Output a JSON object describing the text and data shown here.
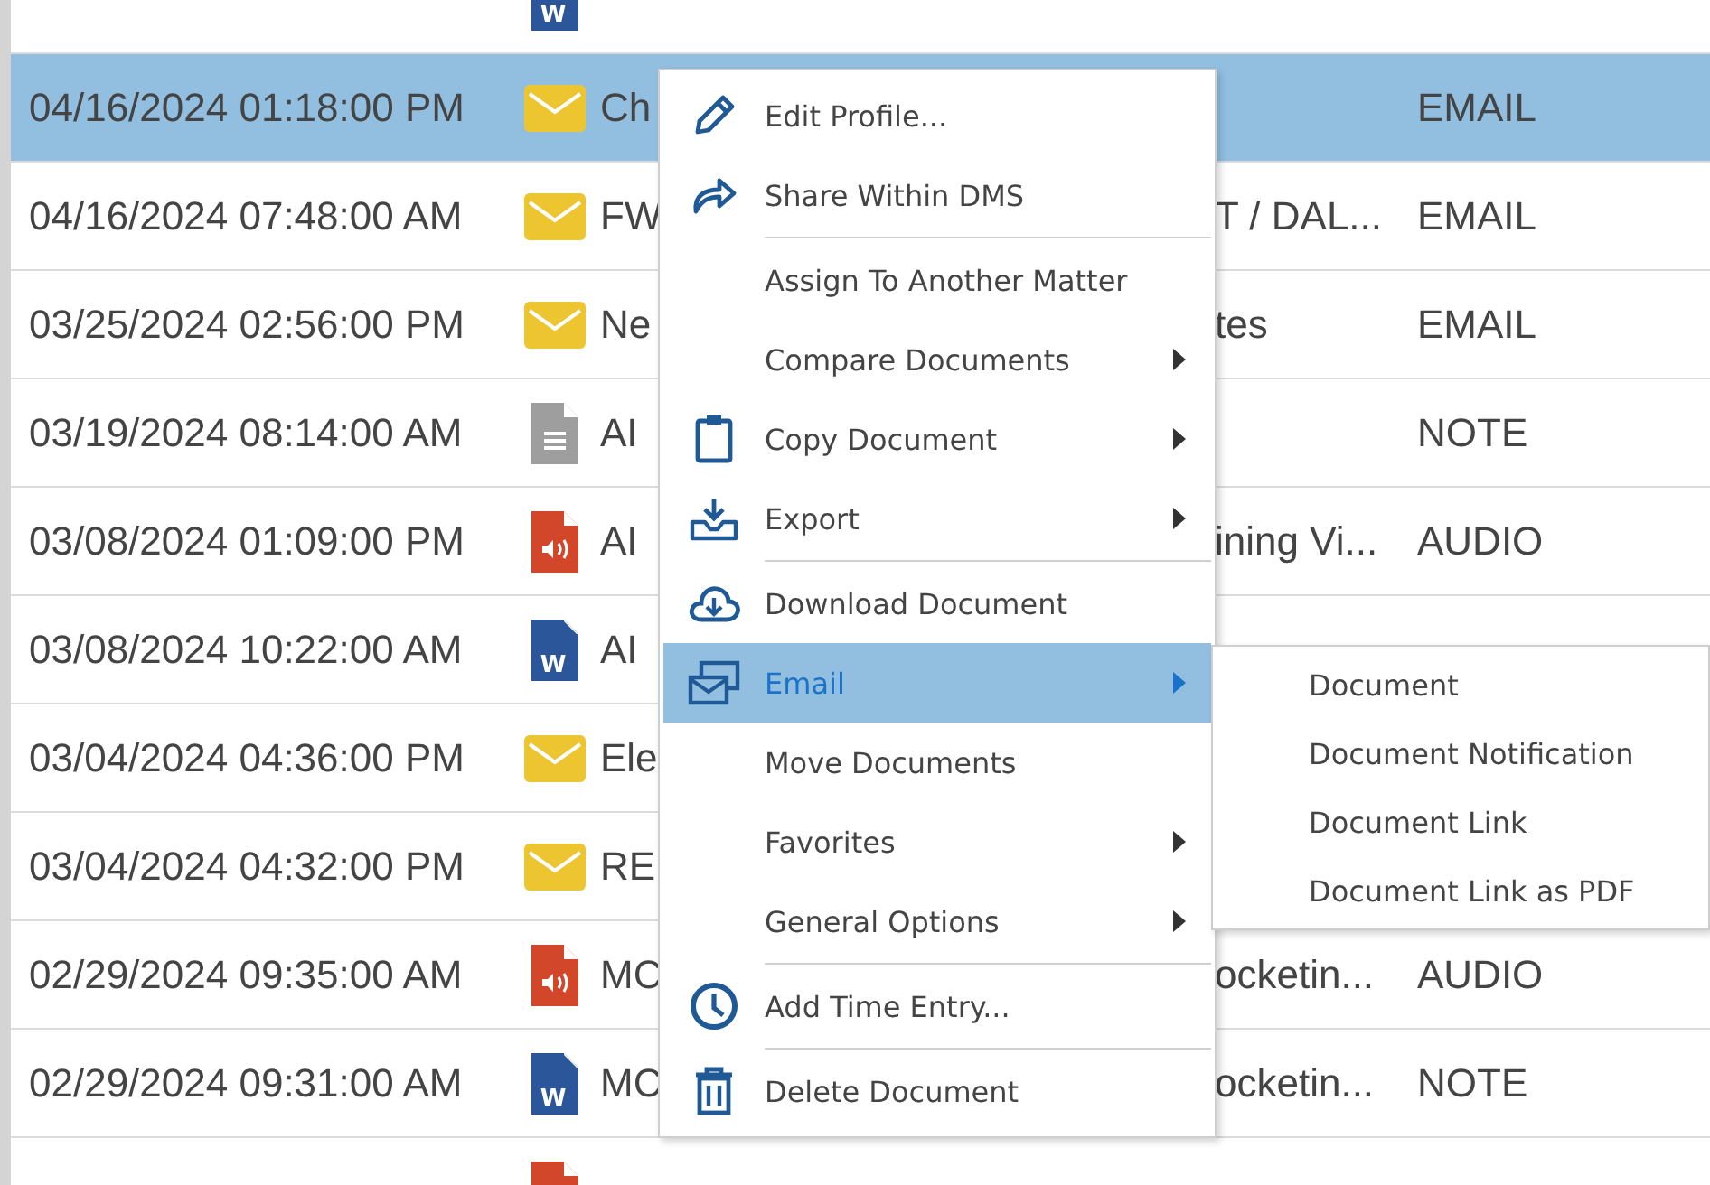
{
  "rows": [
    {
      "date": "",
      "kind": "word",
      "icon_text": "W",
      "name": "",
      "name_tail": "",
      "type": "",
      "selected": false
    },
    {
      "date": "04/16/2024 01:18:00 PM",
      "kind": "email",
      "name": "Ch",
      "name_tail": "",
      "type": "EMAIL",
      "selected": true
    },
    {
      "date": "04/16/2024 07:48:00 AM",
      "kind": "email",
      "name": "FW",
      "name_tail": "T / DAL...",
      "type": "EMAIL",
      "selected": false
    },
    {
      "date": "03/25/2024 02:56:00 PM",
      "kind": "email",
      "name": "Ne",
      "name_tail": "tes",
      "type": "EMAIL",
      "selected": false
    },
    {
      "date": "03/19/2024 08:14:00 AM",
      "kind": "note",
      "name": "AI",
      "name_tail": "",
      "type": "NOTE",
      "selected": false
    },
    {
      "date": "03/08/2024 01:09:00 PM",
      "kind": "audio",
      "name": "AI",
      "name_tail": "ining Vi...",
      "type": "AUDIO",
      "selected": false
    },
    {
      "date": "03/08/2024 10:22:00 AM",
      "kind": "word",
      "icon_text": "W",
      "name": "AI",
      "name_tail": "",
      "type": "",
      "selected": false
    },
    {
      "date": "03/04/2024 04:36:00 PM",
      "kind": "email",
      "name": "Ele",
      "name_tail": "",
      "type": "",
      "selected": false
    },
    {
      "date": "03/04/2024 04:32:00 PM",
      "kind": "email",
      "name": "RE",
      "name_tail": "",
      "type": "",
      "selected": false
    },
    {
      "date": "02/29/2024 09:35:00 AM",
      "kind": "audio",
      "name": "MC",
      "name_tail": "ocketin...",
      "type": "AUDIO",
      "selected": false
    },
    {
      "date": "02/29/2024 09:31:00 AM",
      "kind": "word",
      "icon_text": "W",
      "name": "MC",
      "name_tail": "ocketin...",
      "type": "NOTE",
      "selected": false
    },
    {
      "date": "",
      "kind": "audio",
      "name": "",
      "name_tail": "",
      "type": "",
      "selected": false
    }
  ],
  "context_menu": {
    "items": [
      {
        "label": "Edit Profile...",
        "kind": "pencil",
        "separator_before": false,
        "has_submenu": false,
        "selected": false
      },
      {
        "label": "Share Within DMS",
        "kind": "share",
        "separator_before": false,
        "has_submenu": false,
        "selected": false
      },
      {
        "label": "Assign To Another Matter",
        "kind": "plain",
        "separator_before": true,
        "has_submenu": false,
        "selected": false
      },
      {
        "label": "Compare Documents",
        "kind": "plain",
        "separator_before": false,
        "has_submenu": true,
        "selected": false
      },
      {
        "label": "Copy Document",
        "kind": "clipboard",
        "separator_before": false,
        "has_submenu": true,
        "selected": false
      },
      {
        "label": "Export",
        "kind": "tray",
        "separator_before": false,
        "has_submenu": true,
        "selected": false
      },
      {
        "label": "Download Document",
        "kind": "cloud",
        "separator_before": true,
        "has_submenu": false,
        "selected": false
      },
      {
        "label": "Email",
        "kind": "envelope",
        "separator_before": false,
        "has_submenu": true,
        "selected": true
      },
      {
        "label": "Move Documents",
        "kind": "plain",
        "separator_before": false,
        "has_submenu": false,
        "selected": false
      },
      {
        "label": "Favorites",
        "kind": "plain",
        "separator_before": false,
        "has_submenu": true,
        "selected": false
      },
      {
        "label": "General Options",
        "kind": "plain",
        "separator_before": false,
        "has_submenu": true,
        "selected": false
      },
      {
        "label": "Add Time Entry...",
        "kind": "clock",
        "separator_before": true,
        "has_submenu": false,
        "selected": false
      },
      {
        "label": "Delete Document",
        "kind": "trash",
        "separator_before": true,
        "has_submenu": false,
        "selected": false
      }
    ]
  },
  "submenu": {
    "items": [
      "Document",
      "Document Notification",
      "Document Link",
      "Document Link as PDF"
    ]
  }
}
